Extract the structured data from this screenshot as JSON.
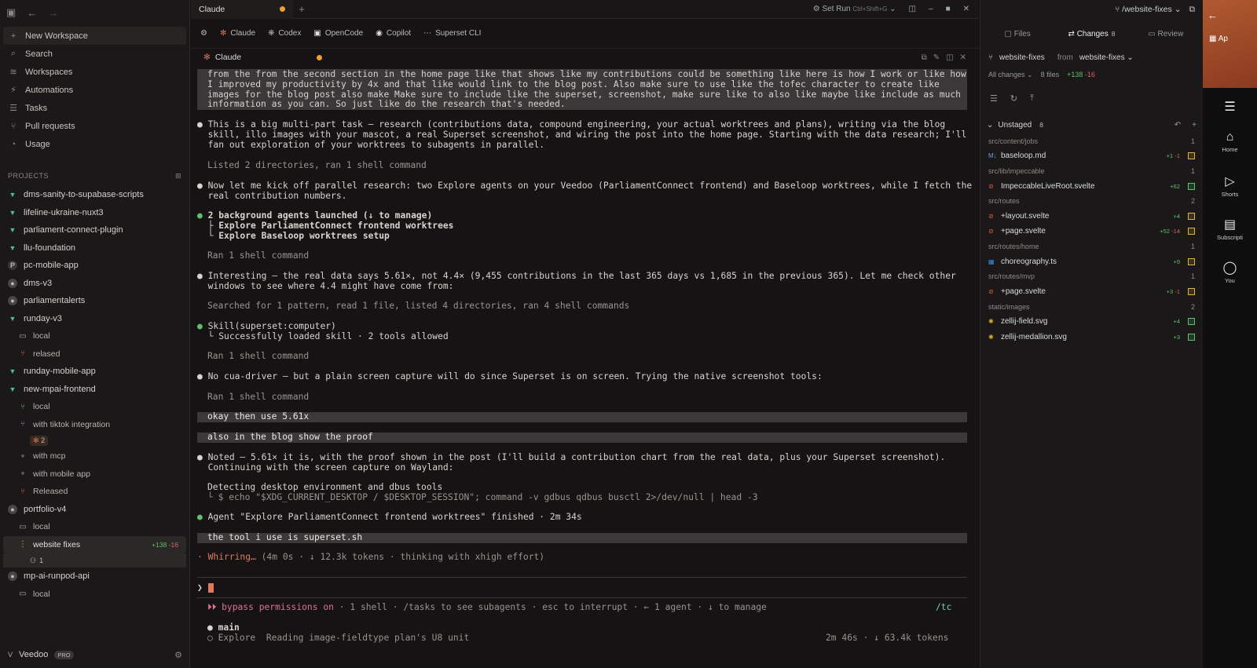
{
  "sidebar": {
    "nav": [
      {
        "icon": "plus-icon",
        "glyph": "+",
        "label": "New Workspace"
      },
      {
        "icon": "search-icon",
        "glyph": "⌕",
        "label": "Search"
      },
      {
        "icon": "layers-icon",
        "glyph": "≋",
        "label": "Workspaces"
      },
      {
        "icon": "bolt-icon",
        "glyph": "⚡",
        "label": "Automations"
      },
      {
        "icon": "checklist-icon",
        "glyph": "☰",
        "label": "Tasks"
      },
      {
        "icon": "git-pull-icon",
        "glyph": "⑂",
        "label": "Pull requests"
      },
      {
        "icon": "gauge-icon",
        "glyph": "◔",
        "label": "Usage"
      }
    ],
    "projects_label": "PROJECTS",
    "projects": [
      {
        "type": "v",
        "label": "dms-sanity-to-supabase-scripts"
      },
      {
        "type": "v",
        "label": "lifeline-ukraine-nuxt3"
      },
      {
        "type": "v",
        "label": "parliament-connect-plugin"
      },
      {
        "type": "v",
        "label": "llu-foundation"
      },
      {
        "type": "p",
        "label": "pc-mobile-app"
      },
      {
        "type": "g",
        "label": "dms-v3"
      },
      {
        "type": "g",
        "label": "parliamentalerts"
      },
      {
        "type": "v",
        "label": "runday-v3"
      }
    ],
    "runday_wt": [
      "local",
      "relased"
    ],
    "projects2": [
      {
        "type": "v",
        "label": "runday-mobile-app"
      },
      {
        "type": "v",
        "label": "new-mpai-frontend"
      }
    ],
    "mpai_wt": [
      "local",
      "with tiktok integration"
    ],
    "mpai_badge": "2",
    "mpai_wt2": [
      "with mcp",
      "with mobile app",
      "Released"
    ],
    "portfolio": "portfolio-v4",
    "portfolio_wt": [
      "local",
      "website fixes"
    ],
    "website_fixes_plus": "+138",
    "website_fixes_minus": "-16",
    "website_fixes_badge": "1",
    "runpod": "mp-ai-runpod-api",
    "runpod_wt": "local",
    "footer_name": "Veedoo",
    "footer_badge": "PRO"
  },
  "tabs": {
    "title": "Claude",
    "set_run": "Set Run",
    "shortcut": "Ctrl+Shift+G"
  },
  "agents": [
    "Claude",
    "Codex",
    "OpenCode",
    "Copilot",
    "Superset CLI"
  ],
  "pane_title": "Claude",
  "terminal": {
    "l1": "from the from the second section in the home page like that shows like my contributions could be something like here is how I work or like how",
    "l2": "I improved my productivity by 4x and that like would link to the blog post. Also make sure to use like the tofec character to create like",
    "l3": "images for the blog post also make Make sure to include like the superset, screenshot, make sure like to also like maybe like include as much",
    "l4": "information as you can. So just like do the research that's needed.",
    "m1a": "This is a big multi-part task — research (contributions data, compound engineering, your actual worktrees and plans), writing via the blog",
    "m1b": "skill, illo images with your mascot, a real Superset screenshot, and wiring the post into the home page. Starting with the data research; I'll",
    "m1c": "fan out exploration of your worktrees to subagents in parallel.",
    "s1": "Listed 2 directories, ran 1 shell command",
    "m2a": "Now let me kick off parallel research: two Explore agents on your Veedoo (ParliamentConnect frontend) and Baseloop worktrees, while I fetch the",
    "m2b": "real contribution numbers.",
    "m3a": "2 background agents launched (↓ to manage)",
    "m3b": "├ Explore ParliamentConnect frontend worktrees",
    "m3c": "└ Explore Baseloop worktrees setup",
    "s2": "Ran 1 shell command",
    "m4a": "Interesting — the real data says 5.61×, not 4.4× (9,455 contributions in the last 365 days vs 1,685 in the previous 365). Let me check other",
    "m4b": "windows to see where 4.4 might have come from:",
    "s3": "Searched for 1 pattern, read 1 file, listed 4 directories, ran 4 shell commands",
    "m5a": "Skill(superset:computer)",
    "m5b": "└ Successfully loaded skill · 2 tools allowed",
    "s4": "Ran 1 shell command",
    "m6": "No cua-driver — but a plain screen capture will do since Superset is on screen. Trying the native screenshot tools:",
    "s5": "Ran 1 shell command",
    "u1": "okay then use 5.61x",
    "u2": "also in the blog show the proof",
    "m7a": "Noted — 5.61× it is, with the proof shown in the post (I'll build a contribution chart from the real data, plus your Superset screenshot).",
    "m7b": "Continuing with the screen capture on Wayland:",
    "m8a": "Detecting desktop environment and dbus tools",
    "m8b": "└ $ echo \"$XDG_CURRENT_DESKTOP / $DESKTOP_SESSION\"; command -v gdbus qdbus busctl 2>/dev/null | head -3",
    "m9": "Agent \"Explore ParliamentConnect frontend worktrees\" finished · 2m 34s",
    "u3": "the tool i use is superset.sh",
    "w1": "Whirring…",
    "w2": " (4m 0s · ↓ 12.3k tokens · thinking with xhigh effort)",
    "status1": "⏵⏵ bypass permissions on",
    "status2": " · 1 shell · /tasks to see subagents · esc to interrupt · ← 1 agent · ↓ to manage",
    "status_right": "/tc",
    "main_label": "main",
    "explore_line": "Explore  Reading image-fieldtype plan's U8 unit",
    "explore_right": "2m 46s · ↓ 63.4k tokens"
  },
  "rpanel": {
    "branch_top": "/website-fixes",
    "tabs": {
      "files": "Files",
      "changes": "Changes",
      "changes_count": "8",
      "review": "Review"
    },
    "branch": "website-fixes",
    "from": "from",
    "from_branch": "website-fixes",
    "all_changes": "All changes",
    "files_count": "8 files",
    "plus": "+138",
    "minus": "-16",
    "unstaged": "Unstaged",
    "unstaged_count": "8",
    "groups": [
      {
        "dir": "src/content/jobs",
        "n": "1",
        "files": [
          {
            "name": "baseloop.md",
            "plus": "+1",
            "minus": "-1",
            "kind": "m",
            "icon": "md"
          }
        ]
      },
      {
        "dir": "src/lib/impeccable",
        "n": "1",
        "files": [
          {
            "name": "ImpeccableLiveRoot.svelte",
            "plus": "+62",
            "minus": "",
            "kind": "a",
            "icon": "svelte"
          }
        ]
      },
      {
        "dir": "src/routes",
        "n": "2",
        "files": [
          {
            "name": "+layout.svelte",
            "plus": "+4",
            "minus": "",
            "kind": "m",
            "icon": "svelte"
          },
          {
            "name": "+page.svelte",
            "plus": "+52",
            "minus": "-14",
            "kind": "m",
            "icon": "svelte"
          }
        ]
      },
      {
        "dir": "src/routes/home",
        "n": "1",
        "files": [
          {
            "name": "choreography.ts",
            "plus": "+9",
            "minus": "",
            "kind": "m",
            "icon": "ts"
          }
        ]
      },
      {
        "dir": "src/routes/mvp",
        "n": "1",
        "files": [
          {
            "name": "+page.svelte",
            "plus": "+3",
            "minus": "-1",
            "kind": "m",
            "icon": "svelte"
          }
        ]
      },
      {
        "dir": "static/images",
        "n": "2",
        "files": [
          {
            "name": "zellij-field.svg",
            "plus": "+4",
            "minus": "",
            "kind": "a",
            "icon": "svg"
          },
          {
            "name": "zellij-medallion.svg",
            "plus": "+3",
            "minus": "",
            "kind": "a",
            "icon": "svg"
          }
        ]
      }
    ]
  },
  "strip": {
    "items": [
      "Home",
      "Shorts",
      "Subscripti",
      "You"
    ],
    "top_label": "Ap"
  }
}
